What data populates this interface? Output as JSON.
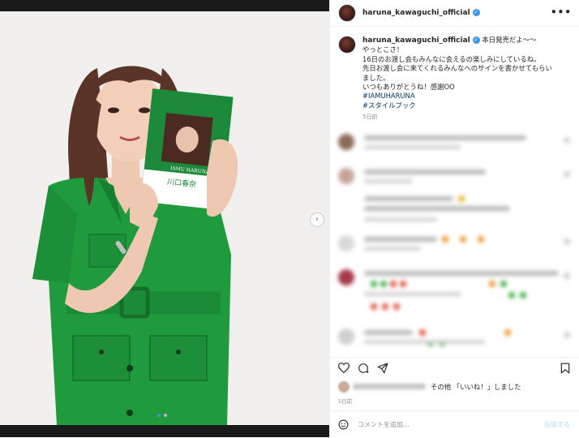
{
  "post": {
    "username": "haruna_kawaguchi_official",
    "caption_first": "本日発売だよ〜〜",
    "caption_lines": [
      "やっとこさ！",
      "16日のお渡し会もみんなに会えるの楽しみにしているね。",
      "先日お渡し会に来てくれるみんなへのサインを書かせてもらい",
      "ました。",
      "いつもありがとうね！感謝OO"
    ],
    "hashtags": [
      "#IAMUHARUNA",
      "#スタイルブック"
    ],
    "time_ago": "5日前",
    "book_cover_title": "IAMU HARUNA",
    "book_cover_name": "川口春奈"
  },
  "engagement": {
    "likes_text": "その他 「いいね！」しました",
    "date": "5日前"
  },
  "composer": {
    "placeholder": "コメントを追加...",
    "post_label": "投稿する"
  },
  "icons": {
    "more": "more-icon",
    "heart": "heart-icon",
    "comment": "comment-icon",
    "share": "share-icon",
    "bookmark": "bookmark-icon",
    "emoji": "emoji-icon",
    "verified": "verified-badge-icon",
    "next": "chevron-right-icon"
  },
  "colors": {
    "accent": "#3897f0",
    "hashtag": "#00376b",
    "dress_green": "#1f9a3d"
  }
}
